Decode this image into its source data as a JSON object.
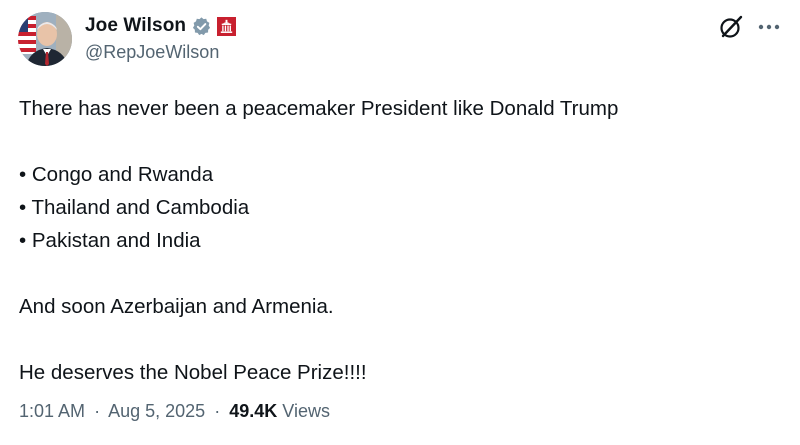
{
  "author": {
    "display_name": "Joe Wilson",
    "handle": "@RepJoeWilson",
    "verified_icon": "verified-badge-icon",
    "affiliation_icon": "us-government-badge-icon"
  },
  "actions": {
    "grok_icon": "grok-icon",
    "more_icon": "more-icon"
  },
  "tweet": {
    "intro": "There has never been a peacemaker President like Donald Trump",
    "bullets": [
      "• Congo and Rwanda",
      "• Thailand and Cambodia",
      "• Pakistan and India"
    ],
    "line_soon": "And soon Azerbaijan and Armenia.",
    "line_nobel": "He deserves the Nobel Peace Prize!!!!"
  },
  "meta": {
    "time": "1:01 AM",
    "separator": "·",
    "date": "Aug 5, 2025",
    "views_count": "49.4K",
    "views_label": "Views"
  },
  "colors": {
    "text": "#0f1419",
    "secondary": "#536471",
    "verified": "#829aab",
    "gov_badge": "#c8202f"
  }
}
